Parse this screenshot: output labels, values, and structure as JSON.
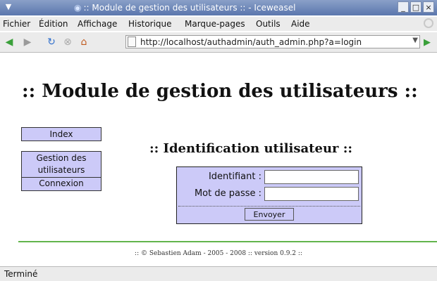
{
  "window": {
    "title": ":: Module de gestion des utilisateurs :: - Iceweasel",
    "controls": [
      "_",
      "□",
      "×"
    ]
  },
  "menu": {
    "items": [
      "Fichier",
      "Édition",
      "Affichage",
      "Historique",
      "Marque-pages",
      "Outils",
      "Aide"
    ]
  },
  "nav": {
    "back_icon": "back-arrow-icon",
    "forward_icon": "forward-arrow-icon",
    "reload_icon": "reload-icon",
    "stop_icon": "stop-icon",
    "home_icon": "home-icon",
    "url": "http://localhost/authadmin/auth_admin.php?a=login",
    "go_icon": "go-arrow-icon"
  },
  "page": {
    "heading": ":: Module de gestion des utilisateurs ::",
    "sidebar": {
      "index": "Index",
      "gestion": "Gestion des utilisateurs",
      "connexion": "Connexion"
    },
    "subheading": ":: Identification utilisateur ::",
    "form": {
      "identifiant_label": "Identifiant :",
      "identifiant_value": "",
      "password_label": "Mot de passe :",
      "password_value": "",
      "submit_label": "Envoyer"
    },
    "footer": ":: © Sebastien Adam - 2005 - 2008 :: version 0.9.2 ::"
  },
  "status": {
    "text": "Terminé"
  },
  "colors": {
    "titlebar": "#5a76ad",
    "nav_bg": "#cccaf8",
    "rule": "#62b44c"
  }
}
